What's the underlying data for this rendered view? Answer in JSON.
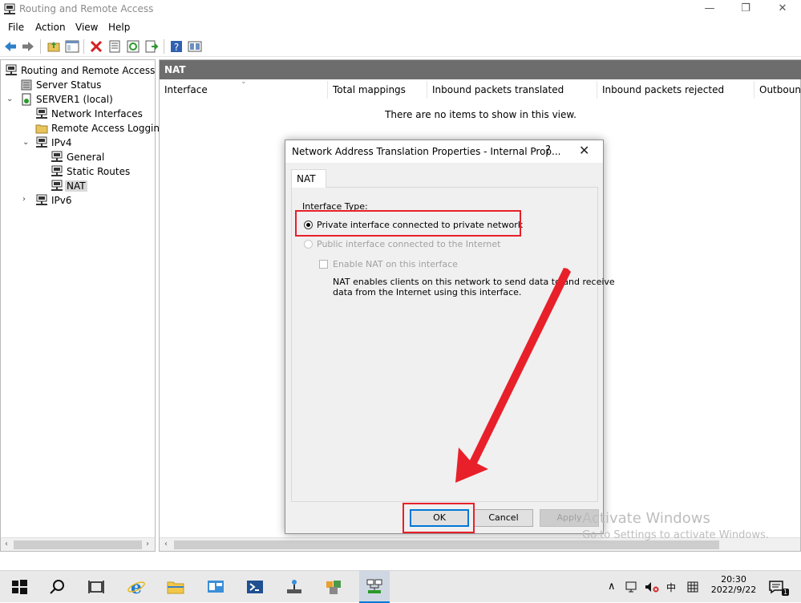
{
  "window": {
    "title": "Routing and Remote Access",
    "controls": {
      "minimize": "—",
      "restore": "❐",
      "close": "✕"
    }
  },
  "menu": {
    "items": [
      "File",
      "Action",
      "View",
      "Help"
    ]
  },
  "toolbar": {
    "icons": [
      "back-icon",
      "forward-icon",
      "up-folder-icon",
      "show-hide-tree-icon",
      "delete-icon",
      "properties-icon",
      "refresh-icon",
      "export-list-icon",
      "help-icon",
      "extra-view-icon"
    ]
  },
  "tree": {
    "root": "Routing and Remote Access",
    "server_status": "Server Status",
    "server": "SERVER1 (local)",
    "network_interfaces": "Network Interfaces",
    "remote_access_logging": "Remote Access Logging",
    "ipv4": "IPv4",
    "general": "General",
    "static_routes": "Static Routes",
    "nat": "NAT",
    "ipv6": "IPv6"
  },
  "panel": {
    "header": "NAT",
    "columns": [
      "Interface",
      "Total mappings",
      "Inbound packets translated",
      "Inbound packets rejected",
      "Outbound"
    ],
    "empty_message": "There are no items to show in this view."
  },
  "dialog": {
    "title": "Network Address Translation Properties - Internal Prop...",
    "help": "?",
    "close": "✕",
    "tab": "NAT",
    "interface_type_label": "Interface Type:",
    "private_option": "Private interface connected to private network",
    "public_option": "Public interface connected to the Internet",
    "enable_nat": "Enable NAT on this interface",
    "nat_description_line1": "NAT enables clients on this network to send data to and receive",
    "nat_description_line2": "data from the Internet using this interface.",
    "selected_option": "private",
    "ok": "OK",
    "cancel": "Cancel",
    "apply": "Apply"
  },
  "watermark": {
    "line1": "Activate Windows",
    "line2": "Go to Settings to activate Windows."
  },
  "taskbar": {
    "tray_lang": "中",
    "time": "20:30",
    "date": "2022/9/22"
  },
  "colors": {
    "accent": "#0078d7",
    "annotation_red": "#e8202a",
    "panel_header": "#6d6d6d"
  }
}
